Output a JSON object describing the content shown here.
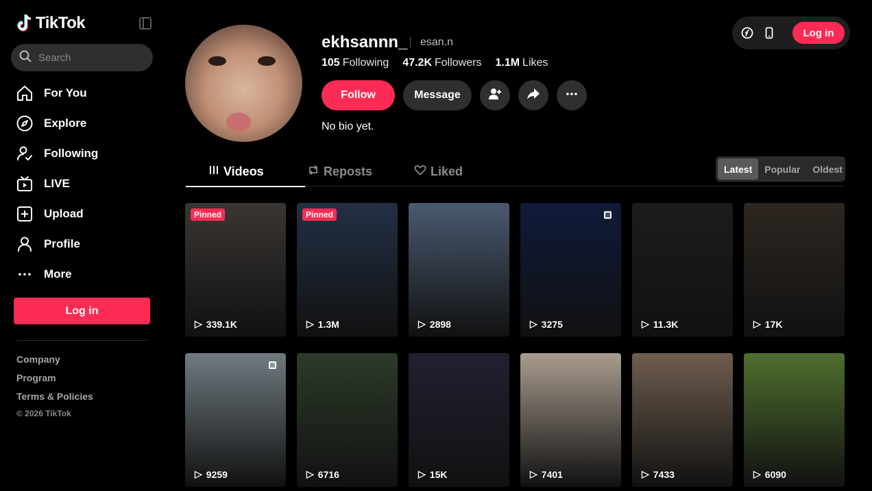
{
  "sidebar": {
    "brand": "TikTok",
    "search_placeholder": "Search",
    "nav": [
      {
        "label": "For You",
        "icon": "home-icon"
      },
      {
        "label": "Explore",
        "icon": "compass-icon"
      },
      {
        "label": "Following",
        "icon": "following-icon"
      },
      {
        "label": "LIVE",
        "icon": "live-tv-icon"
      },
      {
        "label": "Upload",
        "icon": "upload-icon"
      },
      {
        "label": "Profile",
        "icon": "profile-icon"
      },
      {
        "label": "More",
        "icon": "more-icon"
      }
    ],
    "login_label": "Log in",
    "footer": [
      "Company",
      "Program",
      "Terms & Policies"
    ],
    "copyright": "© 2026 TikTok"
  },
  "topbar": {
    "login_label": "Log in"
  },
  "profile": {
    "username": "ekhsannn_",
    "nickname": "esan.n",
    "stats": [
      {
        "value": "105",
        "label": "Following"
      },
      {
        "value": "47.2K",
        "label": "Followers"
      },
      {
        "value": "1.1M",
        "label": "Likes"
      }
    ],
    "follow_label": "Follow",
    "message_label": "Message",
    "bio": "No bio yet."
  },
  "tabs": [
    {
      "label": "Videos",
      "active": true
    },
    {
      "label": "Reposts",
      "active": false
    },
    {
      "label": "Liked",
      "active": false
    }
  ],
  "sort": {
    "options": [
      "Latest",
      "Popular",
      "Oldest"
    ],
    "selected": "Latest"
  },
  "videos": [
    {
      "views": "339.1K",
      "pinned": "Pinned",
      "multi": false,
      "bg": "#3a3633"
    },
    {
      "views": "1.3M",
      "pinned": "Pinned",
      "multi": false,
      "bg": "#223044"
    },
    {
      "views": "2898",
      "pinned": "",
      "multi": false,
      "bg": "#4a5a70"
    },
    {
      "views": "3275",
      "pinned": "",
      "multi": true,
      "bg": "#101a3a"
    },
    {
      "views": "11.3K",
      "pinned": "",
      "multi": false,
      "bg": "#1c1c1c"
    },
    {
      "views": "17K",
      "pinned": "",
      "multi": false,
      "bg": "#2d2620"
    },
    {
      "views": "9259",
      "pinned": "",
      "multi": true,
      "bg": "#6f7a80"
    },
    {
      "views": "6716",
      "pinned": "",
      "multi": false,
      "bg": "#2d3b2a"
    },
    {
      "views": "15K",
      "pinned": "",
      "multi": false,
      "bg": "#202032"
    },
    {
      "views": "7401",
      "pinned": "",
      "multi": false,
      "bg": "#a99c8e"
    },
    {
      "views": "7433",
      "pinned": "",
      "multi": false,
      "bg": "#6e5d4e"
    },
    {
      "views": "6090",
      "pinned": "",
      "multi": false,
      "bg": "#4e6e2e"
    }
  ]
}
